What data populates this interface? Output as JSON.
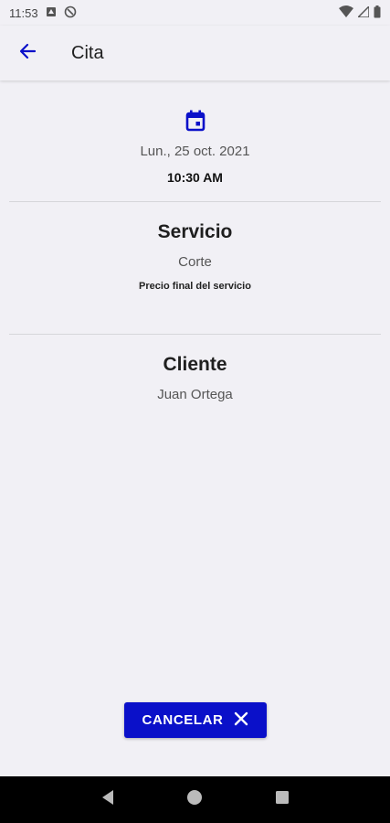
{
  "status_bar": {
    "time": "11:53"
  },
  "app_bar": {
    "title": "Cita"
  },
  "appointment": {
    "date": "Lun., 25 oct. 2021",
    "time": "10:30 AM"
  },
  "service": {
    "title": "Servicio",
    "name": "Corte",
    "price_note": "Precio final del servicio"
  },
  "client": {
    "title": "Cliente",
    "name": "Juan Ortega"
  },
  "actions": {
    "cancel_label": "CANCELAR"
  },
  "colors": {
    "accent": "#0a10c9",
    "background": "#f1f0f5"
  },
  "icons": {
    "back": "arrow-left",
    "calendar": "calendar",
    "cancel": "close",
    "nav_back": "triangle-left",
    "nav_home": "circle",
    "nav_recents": "square"
  }
}
